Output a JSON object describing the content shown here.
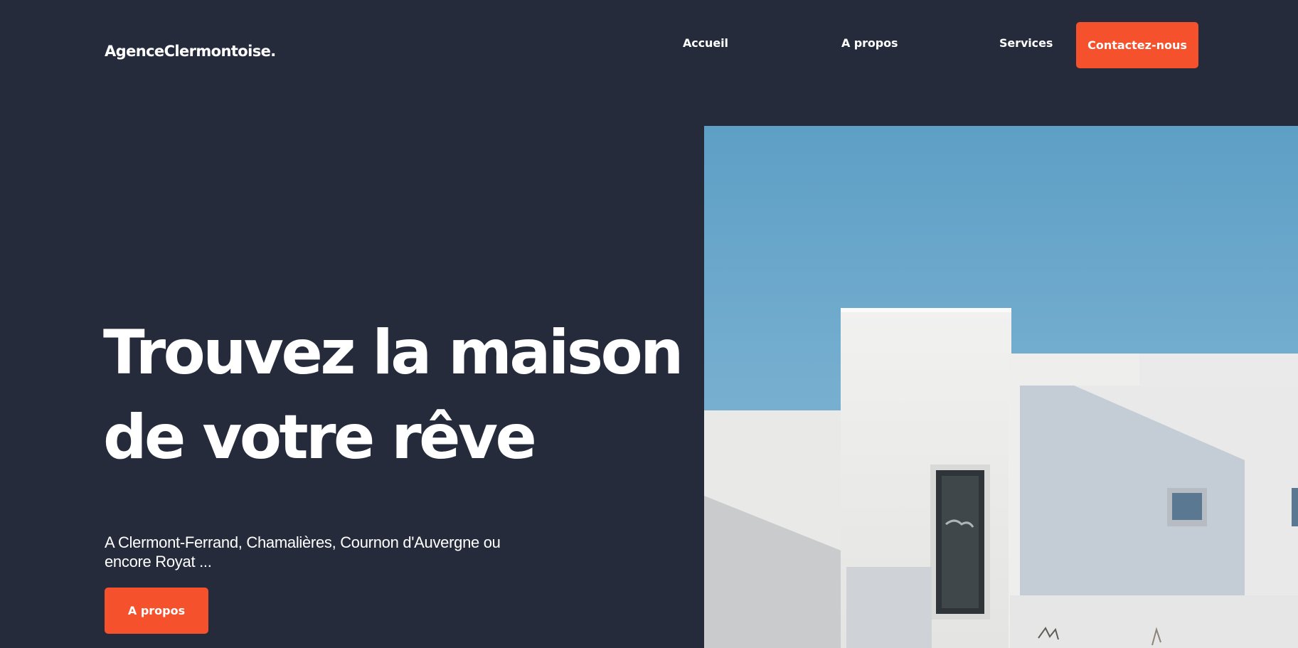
{
  "header": {
    "logo": "AgenceClermontoise.",
    "nav": {
      "home": "Accueil",
      "about": "A propos",
      "services": "Services"
    },
    "cta_label": "Contactez-nous"
  },
  "hero": {
    "title_line1": "Trouvez la maison",
    "title_line2": "de votre rêve",
    "subtitle_line1": "A Clermont-Ferrand, Chamalières, Cournon d'Auvergne ou",
    "subtitle_line2": "encore Royat ...",
    "button_label": "A propos"
  },
  "colors": {
    "background": "#252b3b",
    "accent": "#f4512c",
    "text": "#ffffff"
  }
}
